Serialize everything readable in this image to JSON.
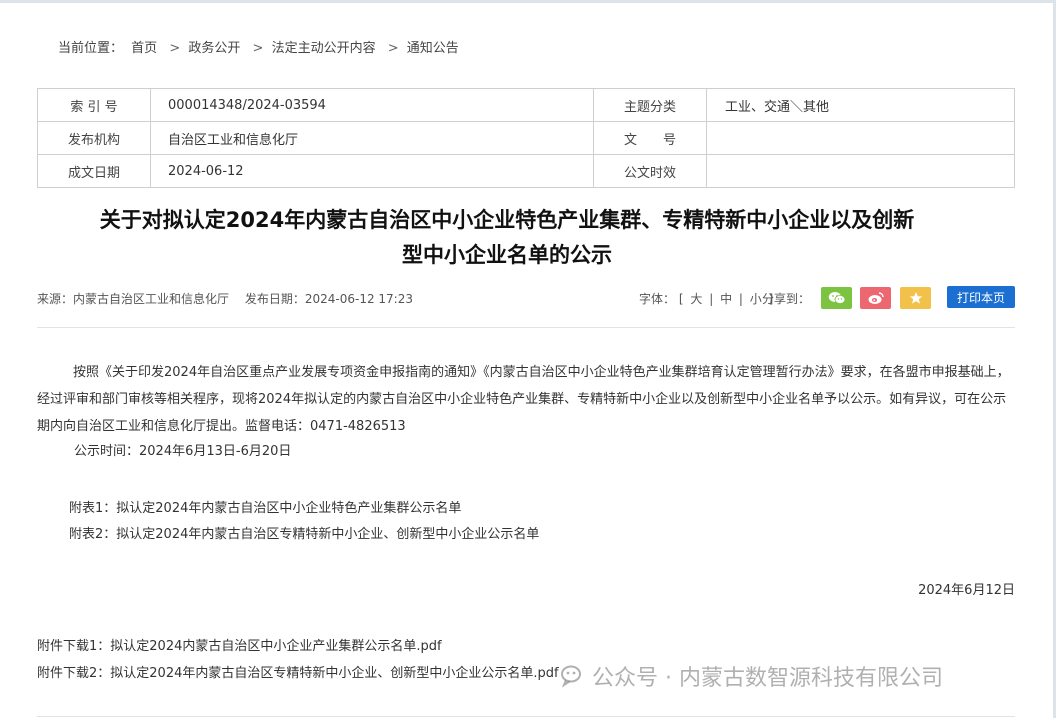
{
  "breadcrumb": {
    "prefix": "当前位置：",
    "items": [
      "首页",
      "政务公开",
      "法定主动公开内容",
      "通知公告"
    ],
    "sep": ">"
  },
  "meta_table": {
    "row1": {
      "k1": "索 引 号",
      "v1": "000014348/2024-03594",
      "k2": "主题分类",
      "v2": "工业、交通＼其他"
    },
    "row2": {
      "k1": "发布机构",
      "v1": "自治区工业和信息化厅",
      "k2": "文　　号",
      "v2": ""
    },
    "row3": {
      "k1": "成文日期",
      "v1": "2024-06-12",
      "k2": "公文时效",
      "v2": ""
    }
  },
  "article": {
    "title_line1": "关于对拟认定2024年内蒙古自治区中小企业特色产业集群、专精特新中小企业以及创新",
    "title_line2": "型中小企业名单的公示",
    "source": "来源：内蒙古自治区工业和信息化厅",
    "publish": "发布日期：2024-06-12 17:23",
    "body": "按照《关于印发2024年自治区重点产业发展专项资金申报指南的通知》《内蒙古自治区中小企业特色产业集群培育认定管理暂行办法》要求，在各盟市申报基础上，经过评审和部门审核等相关程序，现将2024年拟认定的内蒙古自治区中小企业特色产业集群、专精特新中小企业以及创新型中小企业名单予以公示。如有异议，可在公示期内向自治区工业和信息化厅提出。监督电话：0471-4826513",
    "public_period": "公示时间：2024年6月13日-6月20日",
    "attachment1": "附表1：拟认定2024年内蒙古自治区中小企业特色产业集群公示名单",
    "attachment2": "附表2：拟认定2024年内蒙古自治区专精特新中小企业、创新型中小企业公示名单",
    "date": "2024年6月12日",
    "download1_label": "附件下载1：",
    "download1_file": "拟认定2024内蒙古自治区中小企业产业集群公示名单.pdf",
    "download2_label": "附件下载2：",
    "download2_file": "拟认定2024年内蒙古自治区专精特新中小企业、创新型中小企业公示名单.pdf"
  },
  "toolbar": {
    "font_label": "字体：",
    "font_open": "[",
    "font_large": "大",
    "font_medium": "中",
    "font_small": "小",
    "font_close": "]",
    "font_pipe": "|",
    "share_label": "分享到：",
    "share_icons": [
      "wechat-icon",
      "weibo-icon",
      "star-icon"
    ],
    "print_label": "打印本页"
  },
  "watermark": {
    "text": "公众号 · 内蒙古数智源科技有限公司"
  },
  "colors": {
    "wechat": "#7bc341",
    "weibo": "#ec6770",
    "favorite": "#f2c14a",
    "print": "#1a6fd1"
  }
}
